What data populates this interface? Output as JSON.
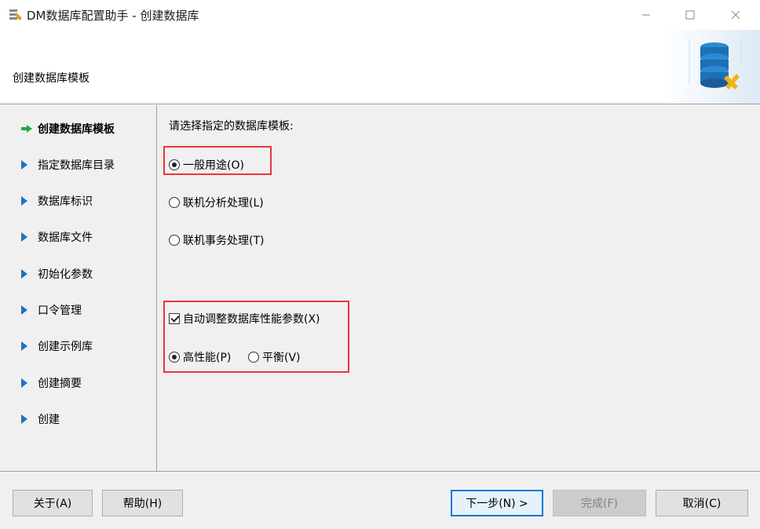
{
  "window": {
    "title": "DM数据库配置助手 - 创建数据库",
    "app_icon": "database-config-icon",
    "controls": [
      "minimize-icon",
      "maximize-icon",
      "close-icon"
    ]
  },
  "header": {
    "title": "创建数据库模板",
    "graphic_icon": "database-tools-icon"
  },
  "nav": {
    "items": [
      {
        "label": "创建数据库模板",
        "marker": "green-arrow-icon",
        "active": true
      },
      {
        "label": "指定数据库目录",
        "marker": "blue-triangle-icon"
      },
      {
        "label": "数据库标识",
        "marker": "blue-triangle-icon"
      },
      {
        "label": "数据库文件",
        "marker": "blue-triangle-icon"
      },
      {
        "label": "初始化参数",
        "marker": "blue-triangle-icon"
      },
      {
        "label": "口令管理",
        "marker": "blue-triangle-icon"
      },
      {
        "label": "创建示例库",
        "marker": "blue-triangle-icon"
      },
      {
        "label": "创建摘要",
        "marker": "blue-triangle-icon"
      },
      {
        "label": "创建",
        "marker": "blue-triangle-icon"
      }
    ]
  },
  "main": {
    "prompt": "请选择指定的数据库模板:",
    "templates": [
      {
        "label": "一般用途(O)",
        "selected": true
      },
      {
        "label": "联机分析处理(L)",
        "selected": false
      },
      {
        "label": "联机事务处理(T)",
        "selected": false
      }
    ],
    "auto_tune": {
      "label": "自动调整数据库性能参数(X)",
      "checked": true
    },
    "perf_modes": [
      {
        "label": "高性能(P)",
        "selected": true
      },
      {
        "label": "平衡(V)",
        "selected": false
      }
    ]
  },
  "footer": {
    "about_label": "关于(A)",
    "help_label": "帮助(H)",
    "next_label": "下一步(N) >",
    "finish_label": "完成(F)",
    "cancel_label": "取消(C)"
  },
  "colors": {
    "accent": "#0078d7",
    "highlight_border": "#e53935",
    "nav_arrow_green": "#1fa845",
    "nav_triangle_blue": "#1e73be"
  }
}
